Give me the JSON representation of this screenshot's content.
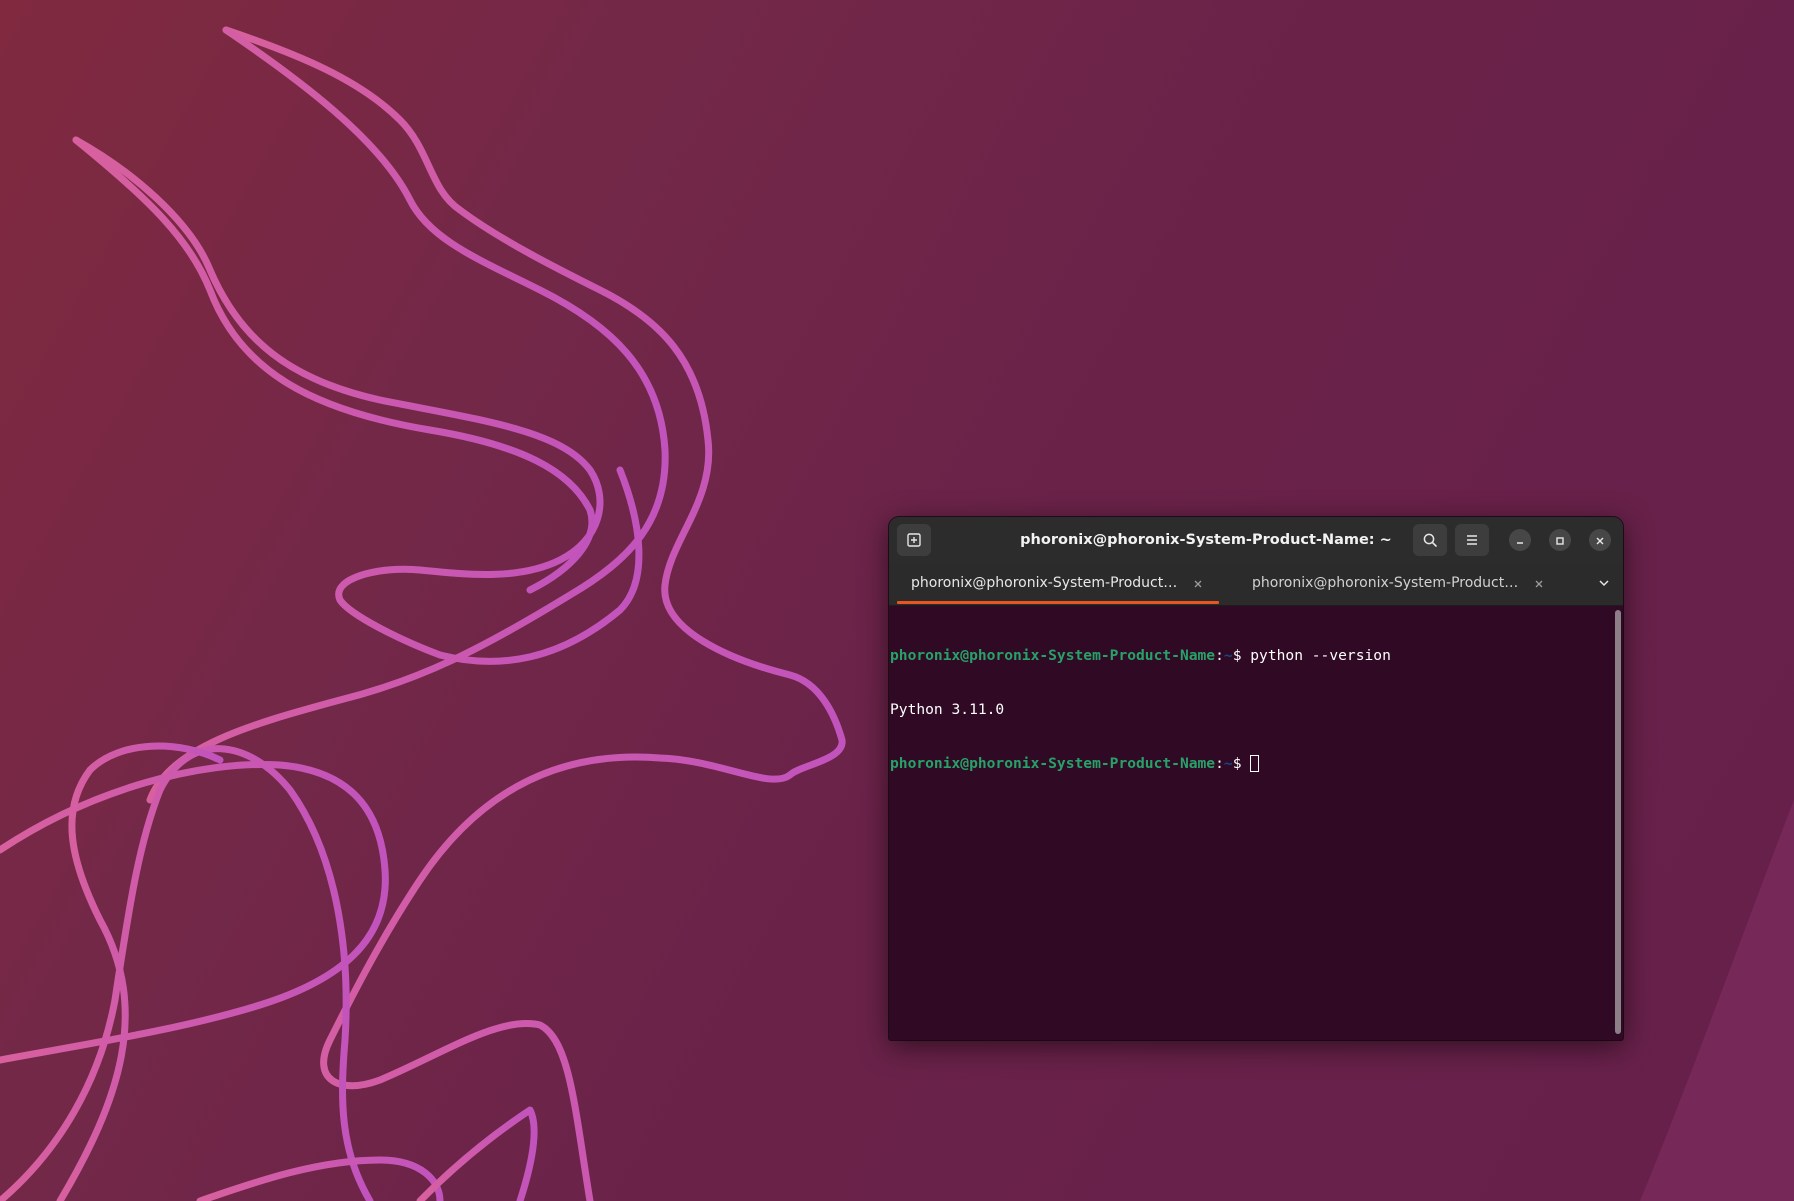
{
  "window": {
    "title": "phoronix@phoronix-System-Product-Name: ~"
  },
  "toolbar": {
    "new_tab_icon": "new-tab-icon",
    "search_icon": "search-icon",
    "menu_icon": "hamburger-menu-icon"
  },
  "window_controls": {
    "minimize_icon": "minimize-icon",
    "maximize_icon": "maximize-icon",
    "close_icon": "close-icon"
  },
  "tabs": [
    {
      "label": "phoronix@phoronix-System-Product-N...",
      "active": true
    },
    {
      "label": "phoronix@phoronix-System-Product-N...",
      "active": false
    }
  ],
  "terminal": {
    "lines": [
      {
        "type": "prompt",
        "user_host": "phoronix@phoronix-System-Product-Name",
        "sep": ":",
        "path": "~",
        "symbol": "$",
        "command": " python --version"
      },
      {
        "type": "output",
        "text": "Python 3.11.0"
      },
      {
        "type": "prompt",
        "user_host": "phoronix@phoronix-System-Product-Name",
        "sep": ":",
        "path": "~",
        "symbol": "$",
        "command": " "
      }
    ]
  },
  "colors": {
    "accent": "#e95420",
    "terminal_bg": "#300a24",
    "prompt_user": "#26a269",
    "prompt_path": "#12488b",
    "wallpaper_line": "#c456b8"
  }
}
